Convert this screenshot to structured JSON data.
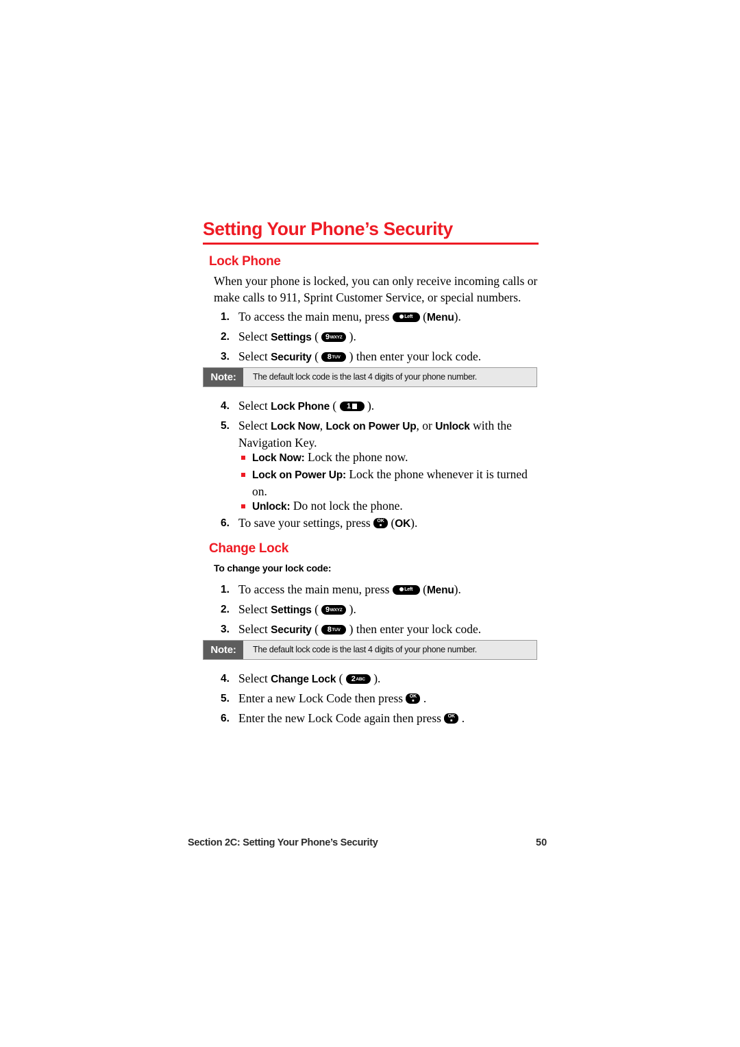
{
  "chapter": {
    "title": "Setting Your Phone’s Security"
  },
  "sections": {
    "lock_phone": {
      "heading": "Lock Phone",
      "intro": "When your phone is locked, you can only receive incoming calls or make calls to 911, Sprint Customer Service, or special numbers.",
      "steps": {
        "s1_num": "1.",
        "s1_a": "To access the main menu, press ",
        "s1_b": " (",
        "s1_bold": "Menu",
        "s1_c": ").",
        "s2_num": "2.",
        "s2_a": "Select ",
        "s2_bold": "Settings",
        "s2_b": " ( ",
        "s2_c": " ).",
        "s3_num": "3.",
        "s3_a": "Select ",
        "s3_bold": "Security",
        "s3_b": " ( ",
        "s3_c": " ) then enter your lock code.",
        "s4_num": "4.",
        "s4_a": "Select ",
        "s4_bold": "Lock Phone",
        "s4_b": " ( ",
        "s4_c": " ).",
        "s5_num": "5.",
        "s5_a": "Select ",
        "s5_bold1": "Lock Now",
        "s5_b": ", ",
        "s5_bold2": "Lock on Power Up",
        "s5_c": ", or ",
        "s5_bold3": "Unlock",
        "s5_d": " with the Navigation Key.",
        "s6_num": "6.",
        "s6_a": "To save your settings, press ",
        "s6_b": " (",
        "s6_bold": "OK",
        "s6_c": ")."
      },
      "bullets": {
        "b1_bold": "Lock Now:",
        "b1_text": " Lock the phone now.",
        "b2_bold": "Lock on Power Up:",
        "b2_text": " Lock the phone whenever it is turned on.",
        "b3_bold": "Unlock:",
        "b3_text": " Do not lock the phone."
      },
      "note": {
        "label": "Note:",
        "text": "The default lock code is the last 4 digits of your phone number."
      }
    },
    "change_lock": {
      "heading": "Change Lock",
      "subhead": "To change your lock code:",
      "steps": {
        "s1_num": "1.",
        "s1_a": "To access the main menu, press ",
        "s1_b": " (",
        "s1_bold": "Menu",
        "s1_c": ").",
        "s2_num": "2.",
        "s2_a": "Select ",
        "s2_bold": "Settings",
        "s2_b": " ( ",
        "s2_c": " ).",
        "s3_num": "3.",
        "s3_a": "Select ",
        "s3_bold": "Security",
        "s3_b": " ( ",
        "s3_c": " ) then enter your lock code.",
        "s4_num": "4.",
        "s4_a": "Select ",
        "s4_bold": "Change Lock",
        "s4_b": " ( ",
        "s4_c": " ).",
        "s5_num": "5.",
        "s5_a": "Enter a new Lock Code then press ",
        "s5_b": " .",
        "s6_num": "6.",
        "s6_a": "Enter the new Lock Code again then press ",
        "s6_b": " ."
      },
      "note": {
        "label": "Note:",
        "text": "The default lock code is the last 4 digits of your phone number."
      }
    }
  },
  "keys": {
    "menu": {
      "label": "Left",
      "name": "menu-left-softkey"
    },
    "nine": {
      "digit": "9",
      "letters": "WXYZ"
    },
    "eight": {
      "digit": "8",
      "letters": "TUV"
    },
    "two": {
      "digit": "2",
      "letters": "ABC"
    },
    "one": {
      "digit": "1",
      "letters": ""
    },
    "ok": {
      "top": "OK",
      "bottom": "■"
    }
  },
  "footer": {
    "left": "Section 2C: Setting Your Phone’s Security",
    "page": "50"
  },
  "colors": {
    "accent_red": "#ee1b24",
    "note_label_bg": "#5d5d5d",
    "note_body_bg": "#e8e8e8"
  }
}
